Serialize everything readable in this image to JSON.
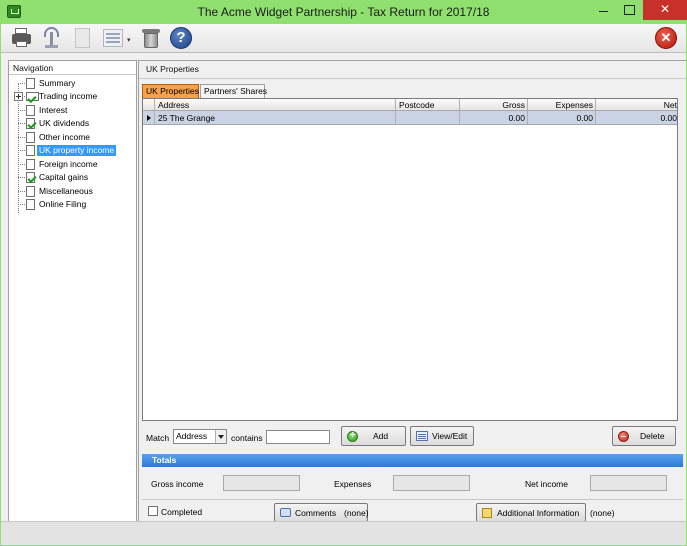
{
  "window": {
    "title": "The Acme Widget Partnership - Tax Return for 2017/18",
    "close_glyph": "✕",
    "accent_color": "#8fe06e"
  },
  "toolbar": {
    "icons": [
      "printer-icon",
      "transmit-tower-icon",
      "document-icon",
      "list-menu-icon",
      "bin-icon",
      "help-icon",
      "exit-icon"
    ],
    "help_glyph": "?",
    "exit_glyph": "✕"
  },
  "nav": {
    "header": "Navigation",
    "items": [
      {
        "label": "Summary",
        "state": "none"
      },
      {
        "label": "Trading income",
        "state": "complete",
        "expandable": true
      },
      {
        "label": "Interest",
        "state": "none"
      },
      {
        "label": "UK dividends",
        "state": "complete"
      },
      {
        "label": "Other income",
        "state": "none"
      },
      {
        "label": "UK property income",
        "state": "selected"
      },
      {
        "label": "Foreign income",
        "state": "none"
      },
      {
        "label": "Capital gains",
        "state": "complete"
      },
      {
        "label": "Miscellaneous",
        "state": "none"
      },
      {
        "label": "Online Filing",
        "state": "none"
      }
    ],
    "selection_color": "#3399ff"
  },
  "content": {
    "section_title": "UK Properties",
    "tabs": [
      {
        "label": "UK Properties",
        "active": true
      },
      {
        "label": "Partners' Shares",
        "active": false
      }
    ],
    "table": {
      "columns": [
        "Address",
        "Postcode",
        "Gross",
        "Expenses",
        "Net"
      ],
      "rows": [
        {
          "address": "25 The Grange",
          "postcode": "",
          "gross": "0.00",
          "expenses": "0.00",
          "net": "0.00"
        }
      ]
    },
    "filter": {
      "match_label": "Match",
      "match_field": "Address",
      "contains_label": "contains",
      "contains_value": ""
    },
    "buttons": {
      "add": "Add",
      "view_edit": "View/Edit",
      "delete": "Delete"
    },
    "totals": {
      "header": "Totals",
      "gross_label": "Gross income",
      "expenses_label": "Expenses",
      "net_label": "Net income",
      "gross_value": "",
      "expenses_value": "",
      "net_value": ""
    },
    "footer": {
      "completed_label": "Completed",
      "completed": false,
      "comments_button": "Comments",
      "comments_status": "(none)",
      "info_button": "Additional Information",
      "info_status": "(none)"
    }
  }
}
